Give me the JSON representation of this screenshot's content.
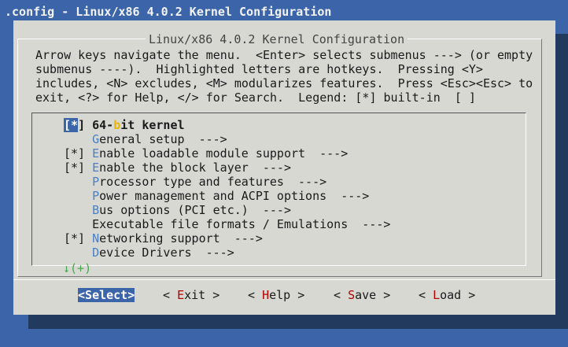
{
  "window": {
    "title": ".config - Linux/x86 4.0.2 Kernel Configuration"
  },
  "dialog": {
    "title": "Linux/x86 4.0.2 Kernel Configuration",
    "info_lines": [
      "Arrow keys navigate the menu.  <Enter> selects submenus ---> (or empty",
      "submenus ----).  Highlighted letters are hotkeys.  Pressing <Y>",
      "includes, <N> excludes, <M> modularizes features.  Press <Esc><Esc> to",
      "exit, <?> for Help, </> for Search.  Legend: [*] built-in  [ ]"
    ]
  },
  "menu": {
    "selected_index": 0,
    "items": [
      {
        "prefix": "[*] ",
        "pre": "64-",
        "hotkey": "b",
        "post": "it kernel",
        "arrow": ""
      },
      {
        "prefix": "    ",
        "pre": "",
        "hotkey": "G",
        "post": "eneral setup",
        "arrow": "  --->"
      },
      {
        "prefix": "[*] ",
        "pre": "",
        "hotkey": "E",
        "post": "nable loadable module support",
        "arrow": "  --->"
      },
      {
        "prefix": "[*] ",
        "pre": "",
        "hotkey": "E",
        "post": "nable the block layer",
        "arrow": "  --->"
      },
      {
        "prefix": "    ",
        "pre": "",
        "hotkey": "P",
        "post": "rocessor type and features",
        "arrow": "  --->"
      },
      {
        "prefix": "    ",
        "pre": "",
        "hotkey": "P",
        "post": "ower management and ACPI options",
        "arrow": "  --->"
      },
      {
        "prefix": "    ",
        "pre": "",
        "hotkey": "B",
        "post": "us options (PCI etc.)",
        "arrow": "  --->"
      },
      {
        "prefix": "    ",
        "pre": "",
        "hotkey": "",
        "post": "Executable file formats / Emulations",
        "arrow": "  --->"
      },
      {
        "prefix": "[*] ",
        "pre": "",
        "hotkey": "N",
        "post": "etworking support",
        "arrow": "  --->"
      },
      {
        "prefix": "    ",
        "pre": "",
        "hotkey": "D",
        "post": "evice Drivers",
        "arrow": "  --->"
      }
    ],
    "more_indicator": "↓(+)"
  },
  "buttons": [
    {
      "name": "select-button",
      "open": "<",
      "hot": "S",
      "rest": "elect",
      "close": ">",
      "active": true
    },
    {
      "name": "exit-button",
      "open": "< ",
      "hot": "E",
      "rest": "xit",
      "close": " >",
      "active": false
    },
    {
      "name": "help-button",
      "open": "< ",
      "hot": "H",
      "rest": "elp",
      "close": " >",
      "active": false
    },
    {
      "name": "save-button",
      "open": "< ",
      "hot": "S",
      "rest": "ave",
      "close": " >",
      "active": false
    },
    {
      "name": "load-button",
      "open": "< ",
      "hot": "L",
      "rest": "oad",
      "close": " >",
      "active": false
    }
  ],
  "colors": {
    "background": "#3b65a8",
    "dialog": "#d7d8d2",
    "hotkey": "#4a7fc6",
    "button_hotkey": "#b30000"
  }
}
